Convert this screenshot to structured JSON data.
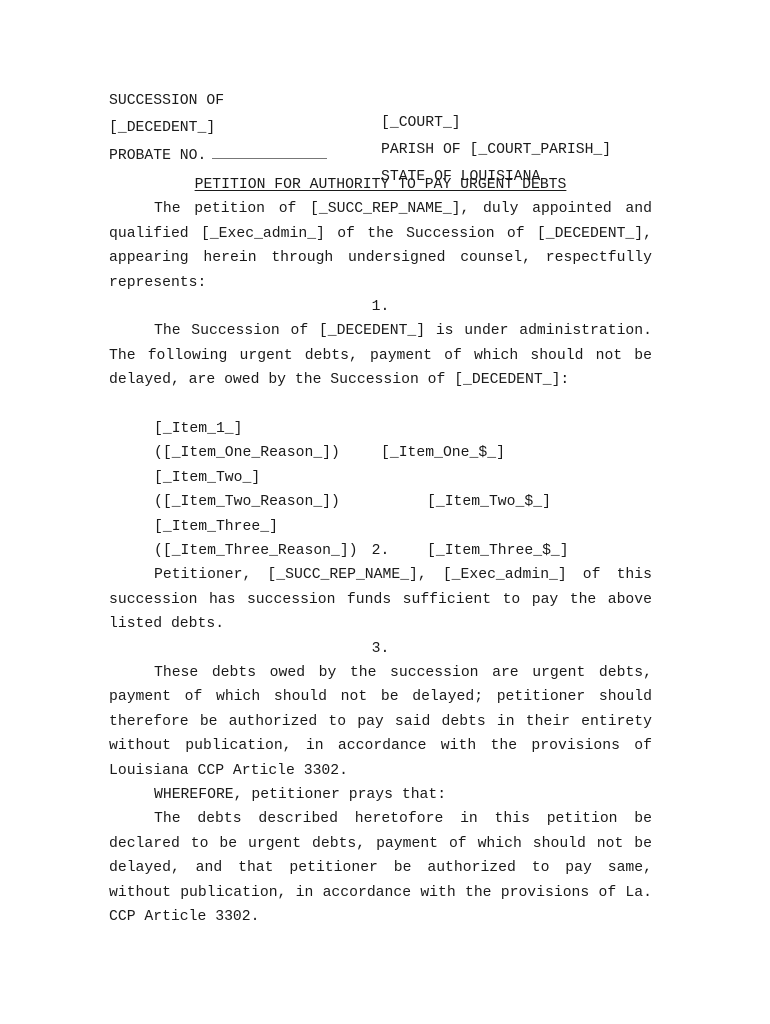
{
  "caption": {
    "left": [
      "SUCCESSION OF",
      "[_DECEDENT_]",
      "PROBATE NO."
    ],
    "right": [
      "[_COURT_]",
      "PARISH OF [_COURT_PARISH_]",
      "STATE OF LOUISIANA"
    ]
  },
  "title": "PETITION FOR AUTHORITY TO PAY URGENT DEBTS",
  "intro": "The petition of [_SUCC_REP_NAME_], duly appointed and qualified [_Exec_admin_] of the Succession of [_DECEDENT_], appearing herein through undersigned counsel, respectfully represents:",
  "sections": [
    {
      "number": "1.",
      "text": "The Succession of [_DECEDENT_] is under administration. The following urgent debts, payment of which should not be delayed, are owed by the Succession of [_DECEDENT_]:"
    },
    {
      "number": "2.",
      "text": "Petitioner, [_SUCC_REP_NAME_], [_Exec_admin_] of this succession has succession funds sufficient to pay the above listed debts."
    },
    {
      "number": "3.",
      "text": "These debts owed by the succession are urgent debts, payment of which should not be delayed; petitioner should therefore be authorized to pay said debts in their entirety without publication, in accordance with the provisions of Louisiana CCP Article 3302."
    }
  ],
  "items": [
    {
      "name": "[_Item_1_]",
      "amount": "[_Item_One_$_]",
      "reason": "([_Item_One_Reason_])"
    },
    {
      "name": "[_Item_Two_]",
      "amount": "[_Item_Two_$_]",
      "reason": "([_Item_Two_Reason_])"
    },
    {
      "name": "[_Item_Three_]",
      "amount": "[_Item_Three_$_]",
      "reason": "([_Item_Three_Reason_])"
    }
  ],
  "wherefore": "WHEREFORE, petitioner prays that:",
  "prayer": "The debts described heretofore in this petition be declared to be urgent debts, payment of which should not be delayed, and that petitioner be authorized to pay same, without publication, in accordance with the provisions of La. CCP Article 3302."
}
